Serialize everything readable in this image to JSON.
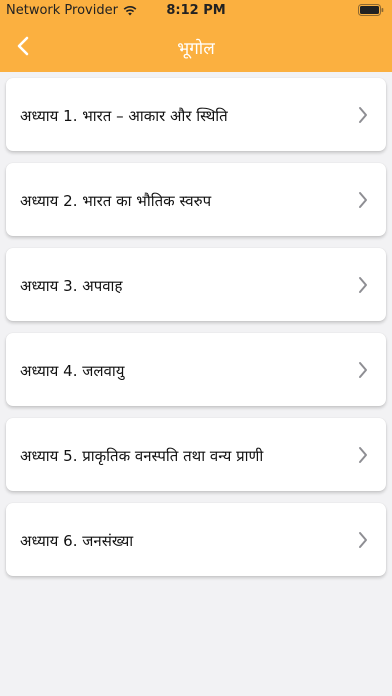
{
  "status_bar": {
    "carrier": "Network Provider",
    "time": "8:12 PM"
  },
  "navbar": {
    "title": "भूगोल",
    "back_icon": "chevron-left-icon"
  },
  "chapters": [
    {
      "label": "अध्याय 1. भारत – आकार और स्थिति"
    },
    {
      "label": "अध्याय 2. भारत का भौतिक स्वरुप"
    },
    {
      "label": "अध्याय 3. अपवाह"
    },
    {
      "label": "अध्याय 4. जलवायु"
    },
    {
      "label": "अध्याय 5. प्राकृतिक वनस्पति तथा वन्य प्राणी"
    },
    {
      "label": "अध्याय 6. जनसंख्या"
    }
  ],
  "colors": {
    "header": "#fbb040",
    "background": "#f2f2f4",
    "card": "#ffffff",
    "chevron": "#8e8e93"
  }
}
